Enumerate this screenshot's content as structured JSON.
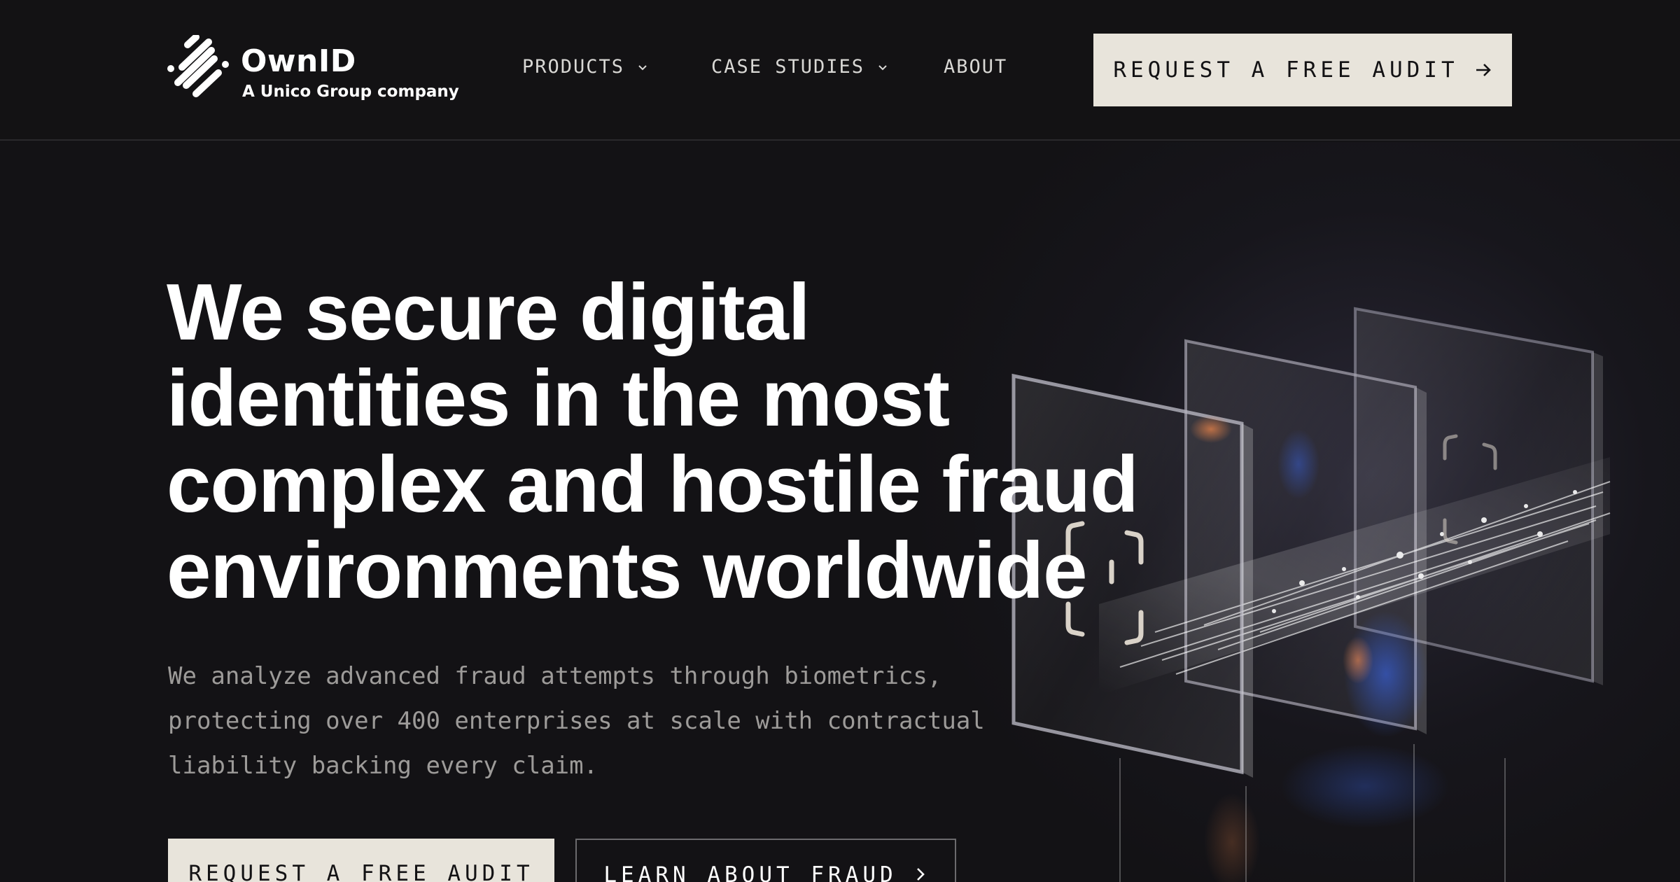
{
  "brand": {
    "name": "OwnID",
    "tagline": "A Unico Group company",
    "logo_icon": "ownid-logo-mark"
  },
  "nav": {
    "items": [
      {
        "label": "PRODUCTS",
        "has_dropdown": true,
        "icon": "chevron-down-icon"
      },
      {
        "label": "CASE STUDIES",
        "has_dropdown": true,
        "icon": "chevron-down-icon"
      },
      {
        "label": "ABOUT",
        "has_dropdown": false
      }
    ],
    "cta_label": "REQUEST A FREE AUDIT",
    "cta_icon": "arrow-right-icon"
  },
  "hero": {
    "title_lines": [
      "We secure digital",
      "identities in the most",
      "complex and hostile fraud",
      "environments worldwide"
    ],
    "description_lines": [
      "We analyze advanced fraud attempts through biometrics,",
      "protecting over 400 enterprises at scale with contractual",
      "liability backing every claim."
    ],
    "primary_cta": "REQUEST A FREE AUDIT",
    "secondary_cta": "LEARN ABOUT FRAUD",
    "secondary_cta_icon": "chevron-right-icon",
    "visual": "glass-panels-face-scan-illustration"
  },
  "colors": {
    "background": "#131215",
    "button_bg": "#e8e4db",
    "button_text": "#131214",
    "description": "#9d9b99",
    "accent_blue": "#2f5bd6",
    "accent_orange": "#e07a3a"
  }
}
